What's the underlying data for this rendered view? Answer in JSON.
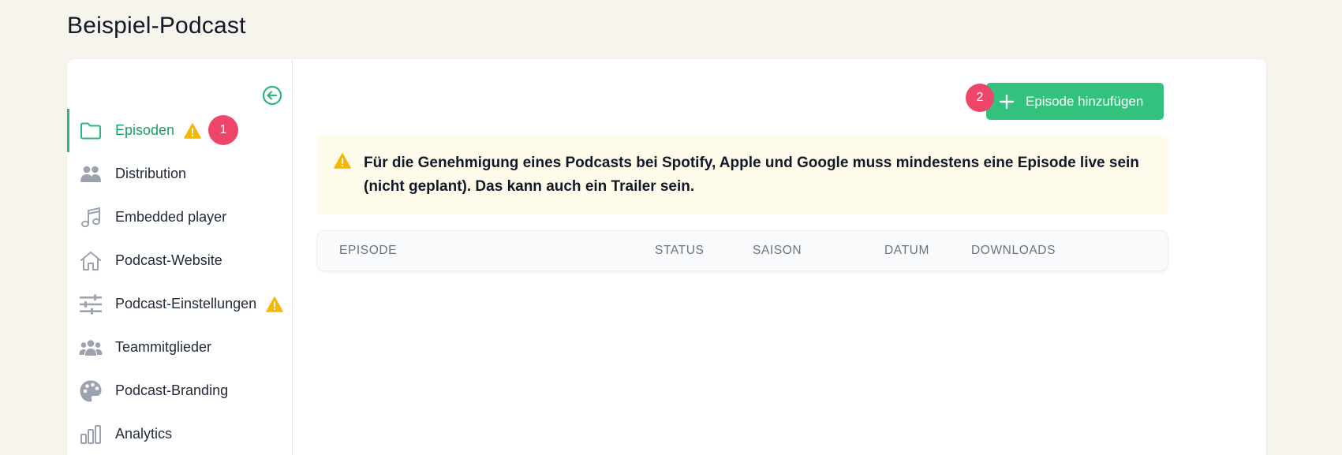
{
  "page": {
    "title": "Beispiel-Podcast"
  },
  "sidebar": {
    "items": [
      {
        "label": "Episoden",
        "icon": "folder-icon",
        "active": true,
        "warning": true,
        "badge": "1"
      },
      {
        "label": "Distribution",
        "icon": "users-icon"
      },
      {
        "label": "Embedded player",
        "icon": "music-note-icon"
      },
      {
        "label": "Podcast-Website",
        "icon": "home-icon"
      },
      {
        "label": "Podcast-Einstellungen",
        "icon": "sliders-icon",
        "warning": true
      },
      {
        "label": "Teammitglieder",
        "icon": "team-icon"
      },
      {
        "label": "Podcast-Branding",
        "icon": "palette-icon"
      },
      {
        "label": "Analytics",
        "icon": "bar-chart-icon"
      }
    ]
  },
  "main": {
    "add_button": {
      "label": "Episode hinzufügen",
      "badge": "2"
    },
    "alert": {
      "text": "Für die Genehmigung eines Podcasts bei Spotify, Apple und Google muss mindestens eine Episode live sein (nicht geplant). Das kann auch ein Trailer sein."
    },
    "table": {
      "columns": [
        "EPISODE",
        "STATUS",
        "SAISON",
        "DATUM",
        "DOWNLOADS"
      ]
    }
  },
  "colors": {
    "accent": "#33c27d",
    "active_text": "#1a9e63",
    "badge": "#f0456a",
    "warning": "#f5b700",
    "alert_bg": "#fffbea",
    "page_bg": "#f7f4ee"
  }
}
